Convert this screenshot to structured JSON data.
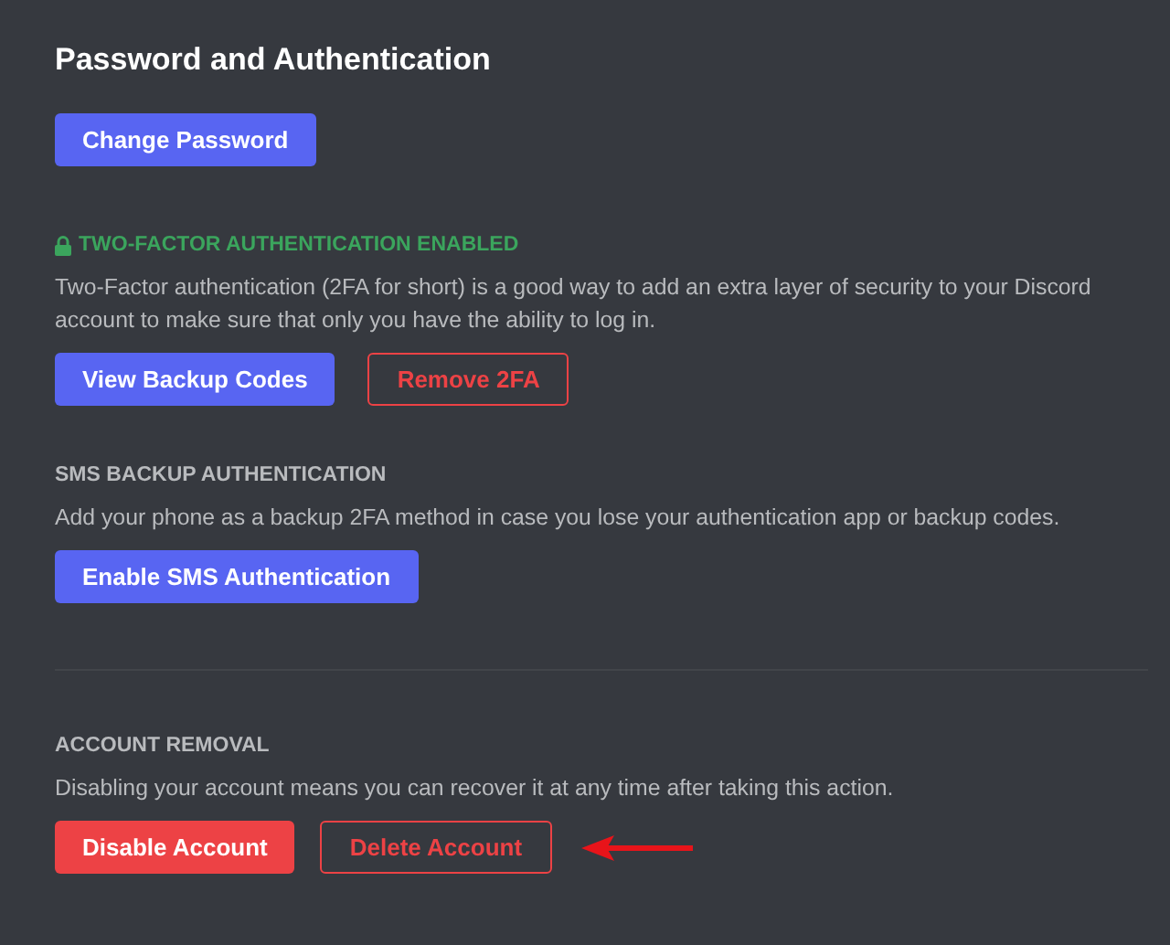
{
  "title": "Password and Authentication",
  "sections": [
    {
      "kind": "plain",
      "buttons": [
        {
          "label": "Change Password",
          "kind": "filled-blurple"
        }
      ]
    },
    {
      "heading": "TWO-FACTOR AUTHENTICATION ENABLED",
      "kind": "enabled",
      "description": "Two-Factor authentication (2FA for short) is a good way to add an extra layer of security to your Discord account to make sure that only you have the ability to log in.",
      "buttons": [
        {
          "label": "View Backup Codes",
          "kind": "filled-blurple"
        },
        {
          "label": "Remove 2FA",
          "kind": "outline-red"
        }
      ]
    },
    {
      "heading": "SMS BACKUP AUTHENTICATION",
      "kind": "plain",
      "description": "Add your phone as a backup 2FA method in case you lose your authentication app or backup codes.",
      "buttons": [
        {
          "label": "Enable SMS Authentication",
          "kind": "filled-blurple"
        }
      ]
    },
    {
      "heading": "ACCOUNT REMOVAL",
      "kind": "divided",
      "description": "Disabling your account means you can recover it at any time after taking this action.",
      "buttons": [
        {
          "label": "Disable Account",
          "kind": "filled-red"
        },
        {
          "label": "Delete Account",
          "kind": "outline-red",
          "highlighted": true
        }
      ]
    }
  ]
}
